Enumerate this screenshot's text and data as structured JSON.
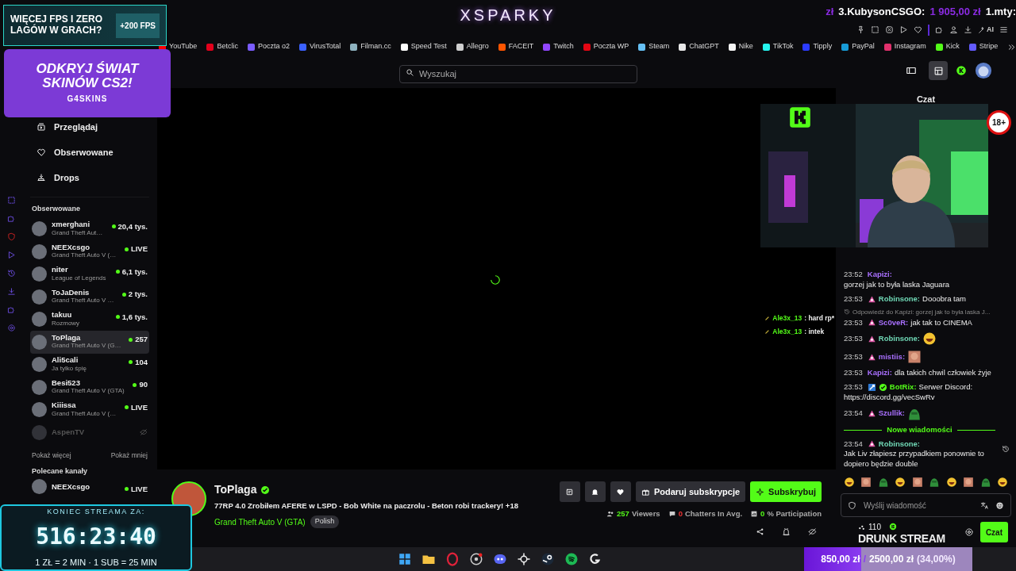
{
  "ads": [
    {
      "headline": "WIĘCEJ FPS I ZERO LAGÓW W GRACH?",
      "badge": "+200 FPS"
    },
    {
      "headline": "ODKRYJ ŚWIAT SKINÓW CS2!",
      "brand": "G4SKINS"
    }
  ],
  "top": {
    "logo": "XSPARKY",
    "ticker": [
      "zł",
      "3.KubysonCSGO:",
      "1 905,00 zł",
      "1.mty:"
    ],
    "toolbar_label": "AI"
  },
  "bookmarks": [
    {
      "label": "YouTube",
      "color": "#ff0000"
    },
    {
      "label": "Betclic",
      "color": "#e3001b"
    },
    {
      "label": "Poczta o2",
      "color": "#7a5cff"
    },
    {
      "label": "VirusTotal",
      "color": "#3b61ff"
    },
    {
      "label": "Filman.cc",
      "color": "#8fb3c0"
    },
    {
      "label": "Speed Test",
      "color": "#ffffff"
    },
    {
      "label": "Allegro",
      "color": "#cfcfcf"
    },
    {
      "label": "FACEIT",
      "color": "#ff5500"
    },
    {
      "label": "Twitch",
      "color": "#9146ff"
    },
    {
      "label": "Poczta WP",
      "color": "#e30613"
    },
    {
      "label": "Steam",
      "color": "#66c0f4"
    },
    {
      "label": "ChatGPT",
      "color": "#e8e8e8"
    },
    {
      "label": "Nike",
      "color": "#f5f5f5"
    },
    {
      "label": "TikTok",
      "color": "#25f4ee"
    },
    {
      "label": "Tipply",
      "color": "#2b3bff"
    },
    {
      "label": "PayPal",
      "color": "#179bd7"
    },
    {
      "label": "Instagram",
      "color": "#e1306c"
    },
    {
      "label": "Kick",
      "color": "#53fc18"
    },
    {
      "label": "Stripe",
      "color": "#635bff"
    }
  ],
  "search": {
    "placeholder": "Wyszukaj"
  },
  "nav": [
    {
      "kind": "browse",
      "label": "Przeglądaj"
    },
    {
      "kind": "following",
      "label": "Obserwowane"
    },
    {
      "kind": "drops",
      "label": "Drops"
    }
  ],
  "followed": {
    "title": "Obserwowane",
    "channels": [
      {
        "name": "xmerghani",
        "subtitle": "Grand Theft Aut…",
        "viewers": "20,4 tys.",
        "online": true,
        "selected": false
      },
      {
        "name": "NEEXcsgo",
        "subtitle": "Grand Theft Auto V (…",
        "viewers": "LIVE",
        "online": true,
        "selected": false
      },
      {
        "name": "niter",
        "subtitle": "League of Legends",
        "viewers": "6,1 tys.",
        "online": true,
        "selected": false
      },
      {
        "name": "ToJaDenis",
        "subtitle": "Grand Theft Auto V …",
        "viewers": "2 tys.",
        "online": true,
        "selected": false
      },
      {
        "name": "takuu",
        "subtitle": "Rozmowy",
        "viewers": "1,6 tys.",
        "online": true,
        "selected": false
      },
      {
        "name": "ToPlaga",
        "subtitle": "Grand Theft Auto V (G…",
        "viewers": "257",
        "online": true,
        "selected": true
      },
      {
        "name": "Ali5cali",
        "subtitle": "Ja tylko śpię",
        "viewers": "104",
        "online": true,
        "selected": false
      },
      {
        "name": "Besi523",
        "subtitle": "Grand Theft Auto V (GTA)",
        "viewers": "90",
        "online": true,
        "selected": false
      },
      {
        "name": "Kiiissa",
        "subtitle": "Grand Theft Auto V (…",
        "viewers": "LIVE",
        "online": true,
        "selected": false
      },
      {
        "name": "AspenTV",
        "online": false,
        "selected": false
      }
    ],
    "show_more": "Pokaż więcej",
    "show_less": "Pokaż mniej"
  },
  "recommended": {
    "title": "Polecane kanały",
    "channels": [
      {
        "name": "NEEXcsgo",
        "viewers": "LIVE"
      }
    ]
  },
  "video_overlay_chat": [
    {
      "user": "Ale3x_13",
      "text": ": hard rp*"
    },
    {
      "user": "Ale3x_13",
      "text": ": intek"
    }
  ],
  "stream": {
    "name": "ToPlaga",
    "verified": true,
    "title": "77RP 4.0 Zrobiłem AFERE w LSPD - Bob White na paczrolu - Beton robi trackery! +18",
    "category": "Grand Theft Auto V (GTA)",
    "tag": "Polish",
    "gift_button": "Podaruj subskrypcje",
    "subscribe_button": "Subskrybuj",
    "stats": [
      {
        "kind": "viewers",
        "value": "257",
        "label": "Viewers"
      },
      {
        "kind": "chatters",
        "value": "0",
        "label": "Chatters In Avg."
      },
      {
        "kind": "participation",
        "value": "0",
        "label": "% Participation"
      }
    ]
  },
  "chat": {
    "title": "Czat",
    "messages": [
      {
        "kind": "text",
        "time": "23:52",
        "user": "Kapizi:",
        "color": "#a970ff",
        "text": "gorzej jak to była laska Jaguara"
      },
      {
        "kind": "text",
        "time": "23:53",
        "subscriber": true,
        "user": "Robinsone:",
        "color": "#6fd6b4",
        "text": "Dooobra tam"
      },
      {
        "kind": "text",
        "reply": "Odpowiedź do Kapizi: gorzej jak to była laska J...",
        "time": "23:53",
        "subscriber": true,
        "user": "Sc0veR:",
        "color": "#a970ff",
        "text": "jak tak to CINEMA"
      },
      {
        "kind": "emote",
        "time": "23:53",
        "subscriber": true,
        "user": "Robinsone:",
        "color": "#6fd6b4"
      },
      {
        "kind": "emote",
        "time": "23:53",
        "subscriber": true,
        "user": "mistiis:",
        "color": "#a970ff"
      },
      {
        "kind": "text",
        "time": "23:53",
        "user": "Kapizi:",
        "color": "#a970ff",
        "text": "dla takich chwil człowiek żyje"
      },
      {
        "kind": "link",
        "time": "23:53",
        "bot": true,
        "verified": true,
        "user": "BotRix:",
        "color": "#53fc18",
        "text": "Serwer Discord:",
        "link": "https://discord.gg/vecSwRv"
      },
      {
        "kind": "emote",
        "time": "23:54",
        "subscriber": true,
        "user": "Szullik:",
        "color": "#a970ff"
      },
      {
        "kind": "divider",
        "text": "Nowe wiadomości"
      },
      {
        "kind": "text",
        "time": "23:54",
        "subscriber": true,
        "user": "Robinsone:",
        "color": "#6fd6b4",
        "text": "Jak Liv złapiesz przypadkiem ponownie to dopiero będzie double"
      }
    ],
    "input_placeholder": "Wyślij wiadomość",
    "send_button": "Czat"
  },
  "overlay": {
    "count": "110",
    "stream_name": "DRUNK STREAM",
    "age_badge": "18+"
  },
  "timer": {
    "label": "KONIEC STREAMA ZA:",
    "time": "516:23:40",
    "rate": "1 ZŁ = 2 MIN · 1 SUB = 25 MIN"
  },
  "goal": {
    "current": "850,00 zł",
    "separator": "/",
    "target": "2500,00 zł",
    "percent": "(34,00%)",
    "level": 0.34
  }
}
